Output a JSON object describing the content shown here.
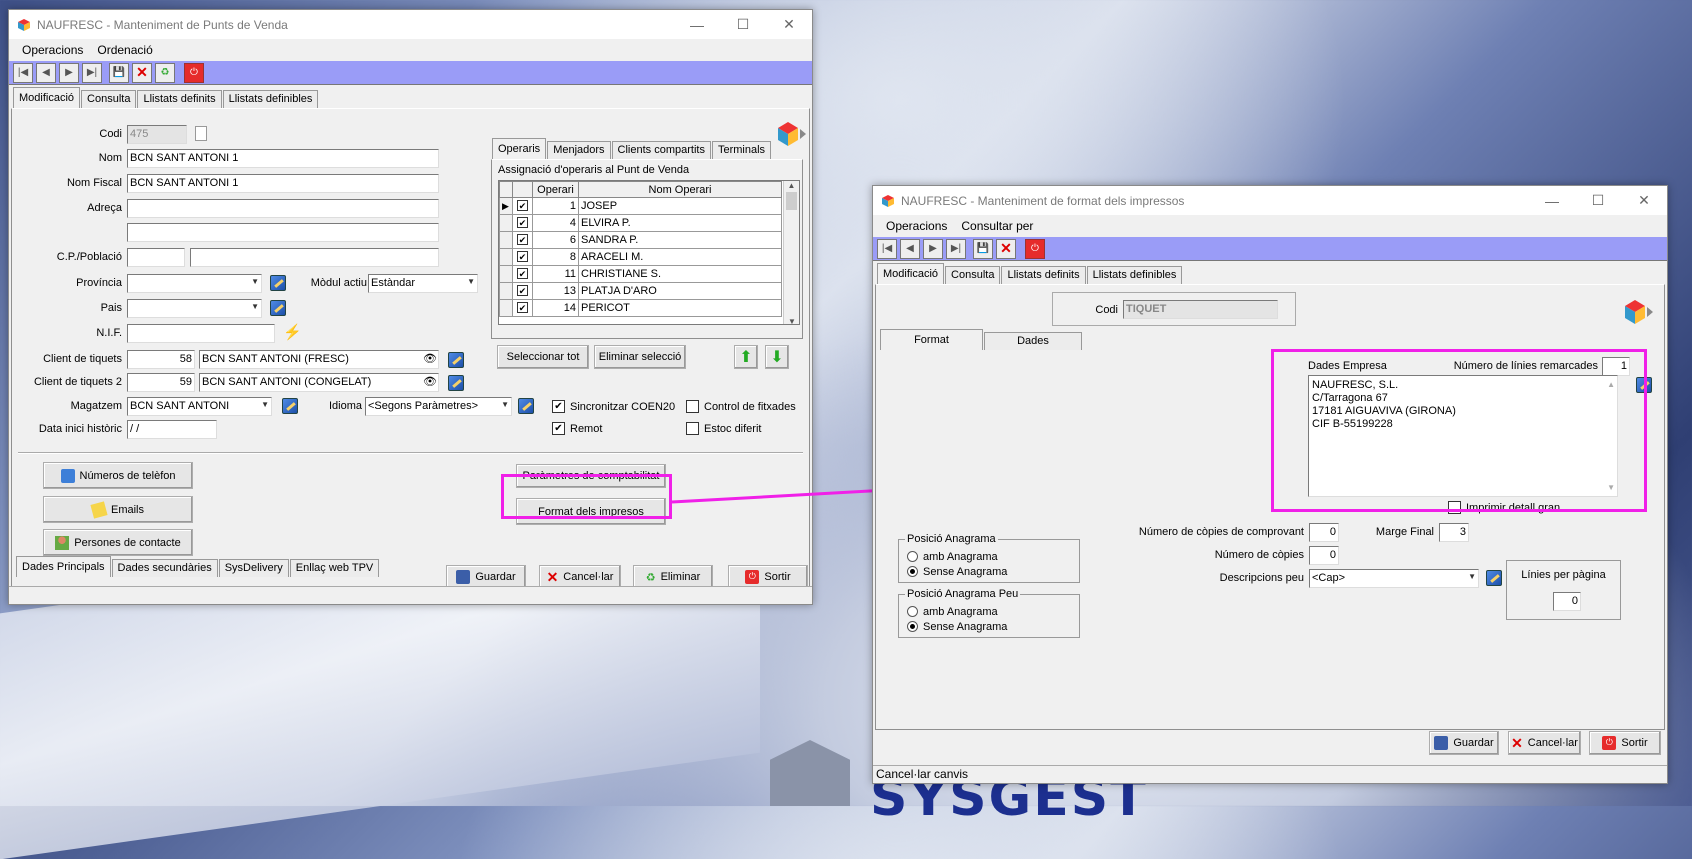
{
  "win1": {
    "title": "NAUFRESC - Manteniment de Punts de Venda",
    "menu": [
      "Operacions",
      "Ordenació"
    ],
    "tabs": [
      "Modificació",
      "Consulta",
      "Llistats definits",
      "Llistats definibles"
    ],
    "fields": {
      "codi_label": "Codi",
      "codi": "475",
      "nom_label": "Nom",
      "nom": "BCN SANT ANTONI 1",
      "nomfiscal_label": "Nom Fiscal",
      "nomfiscal": "BCN SANT ANTONI 1",
      "adreca_label": "Adreça",
      "cp_label": "C.P./Població",
      "provincia_label": "Província",
      "modul_label": "Mòdul actiu",
      "modul": "Estàndar",
      "pais_label": "Pais",
      "nif_label": "N.I.F.",
      "client_label": "Client de tiquets",
      "client_num": "58",
      "client_name": "BCN SANT ANTONI (FRESC)",
      "client2_label": "Client de tiquets 2",
      "client2_num": "59",
      "client2_name": "BCN SANT ANTONI (CONGELAT)",
      "magatzem_label": "Magatzem",
      "magatzem": "BCN SANT ANTONI",
      "idioma_label": "Idioma",
      "idioma": "<Segons Paràmetres>",
      "data_label": "Data inici històric",
      "data": " /  /"
    },
    "checks": {
      "sincronitzar": "Sincronitzar COEN20",
      "remot": "Remot",
      "control": "Control de fitxades",
      "estoc": "Estoc diferit"
    },
    "subtabs": [
      "Operaris",
      "Menjadors",
      "Clients compartits",
      "Terminals"
    ],
    "grid_title": "Assignació d'operaris al Punt de Venda",
    "grid_headers": [
      "Operari",
      "Nom Operari"
    ],
    "operaris": [
      {
        "n": "1",
        "name": "JOSEP"
      },
      {
        "n": "4",
        "name": "ELVIRA P."
      },
      {
        "n": "6",
        "name": "SANDRA P."
      },
      {
        "n": "8",
        "name": "ARACELI M."
      },
      {
        "n": "11",
        "name": "CHRISTIANE S."
      },
      {
        "n": "13",
        "name": "PLATJA D'ARO"
      },
      {
        "n": "14",
        "name": "PERICOT"
      }
    ],
    "buttons": {
      "seleccionar": "Seleccionar tot",
      "eliminar_sel": "Eliminar selecció",
      "telefon": "Números de telèfon",
      "emails": "Emails",
      "persones": "Persones de contacte",
      "comptabilitat": "Paràmetres de comptabilitat",
      "format": "Format dels impresos",
      "guardar": "Guardar",
      "cancelar": "Cancel·lar",
      "eliminar": "Eliminar",
      "sortir": "Sortir"
    },
    "bottom_tabs": [
      "Dades Principals",
      "Dades secundàries",
      "SysDelivery",
      "Enllaç web TPV"
    ]
  },
  "win2": {
    "title": "NAUFRESC - Manteniment de format dels impressos",
    "menu": [
      "Operacions",
      "Consultar per"
    ],
    "tabs": [
      "Modificació",
      "Consulta",
      "Llistats definits",
      "Llistats definibles"
    ],
    "codi_label": "Codi",
    "codi": "TIQUET",
    "inner_tabs": [
      "Format",
      "Dades"
    ],
    "dades_empresa_label": "Dades Empresa",
    "linies_rem_label": "Número de línies remarcades",
    "linies_rem": "1",
    "empresa_text": [
      "NAUFRESC, S.L.",
      "C/Tarragona 67",
      "17181 AIGUAVIVA (GIRONA)",
      "CIF B-55199228"
    ],
    "imprimir_detall": "Imprimir detall gran",
    "copies_compr_label": "Número de còpies de comprovant",
    "copies_compr": "0",
    "marge_label": "Marge Final",
    "marge": "3",
    "copies_label": "Número de còpies",
    "copies": "0",
    "desc_label": "Descripcions peu",
    "desc": "<Cap>",
    "linies_pag_label": "Línies per pàgina",
    "linies_pag": "0",
    "grp1": {
      "title": "Posició Anagrama",
      "opt1": "amb Anagrama",
      "opt2": "Sense Anagrama"
    },
    "grp2": {
      "title": "Posició Anagrama Peu",
      "opt1": "amb Anagrama",
      "opt2": "Sense Anagrama"
    },
    "buttons": {
      "guardar": "Guardar",
      "cancelar": "Cancel·lar",
      "sortir": "Sortir"
    },
    "status": "Cancel·lar canvis"
  },
  "bg_logo": "SYSGEST",
  "colors": {
    "toolbar": "#9a9cf7",
    "highlight": "#f020e8"
  }
}
